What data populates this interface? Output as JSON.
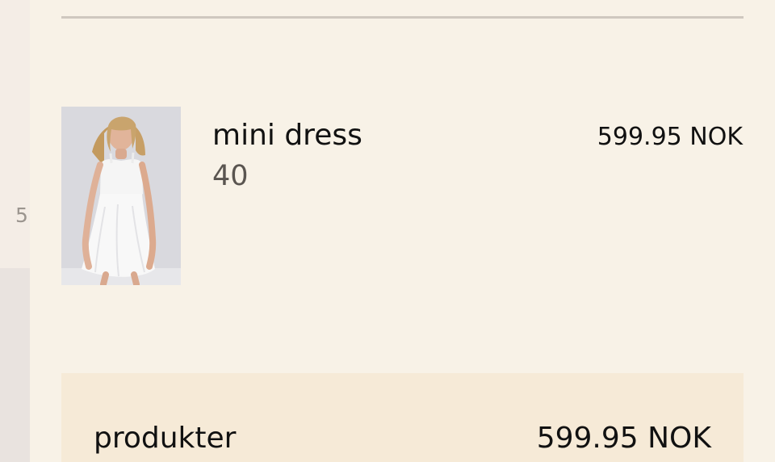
{
  "side_panel": {
    "number": "5"
  },
  "cart_item": {
    "name": "mini dress",
    "size": "40",
    "price": "599.95 NOK",
    "image_icon": "product-photo-white-mini-dress"
  },
  "summary": {
    "products_label": "produkter",
    "products_total": "599.95 NOK"
  },
  "colors": {
    "background": "#f8f2e7",
    "summary_background": "#f6ead7",
    "divider": "#cfc8bf",
    "text_primary": "#111111",
    "text_secondary": "#5a5550"
  }
}
